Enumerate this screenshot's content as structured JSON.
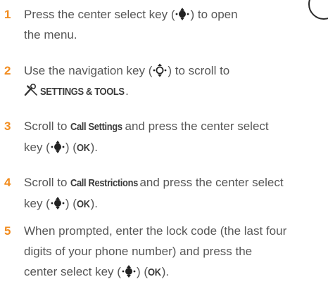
{
  "steps": [
    {
      "number": "1",
      "t1": "Press the center select key (",
      "t2": ") to open",
      "t3": "the menu."
    },
    {
      "number": "2",
      "t1": "Use the navigation key (",
      "t2": ") to scroll to",
      "menu": "SETTINGS & TOOLS",
      "t3": "."
    },
    {
      "number": "3",
      "t1": "Scroll to ",
      "menu1": "Call Settings",
      "t2": " and press the center select",
      "t3": "key (",
      "t4": ") (",
      "menu2": "OK",
      "t5": ")."
    },
    {
      "number": "4",
      "t1": "Scroll to ",
      "menu1": "Call Restrictions",
      "t2": " and press the center select",
      "t3": "key (",
      "t4": ") (",
      "menu2": "OK",
      "t5": ")."
    },
    {
      "number": "5",
      "t1": "When prompted, enter the lock code (the last four",
      "t2": "digits of your phone number) and press the",
      "t3": "center select key (",
      "t4": ") (",
      "menu": "OK",
      "t5": ")."
    }
  ],
  "icons": {
    "center_key": "center-select-key-icon",
    "nav_key": "navigation-key-icon",
    "tools": "settings-tools-icon",
    "corner": "corner-circle-icon"
  },
  "colors": {
    "step_number": "#f28c1e",
    "body_text": "#575757",
    "menu_text": "#3a3a3a"
  }
}
